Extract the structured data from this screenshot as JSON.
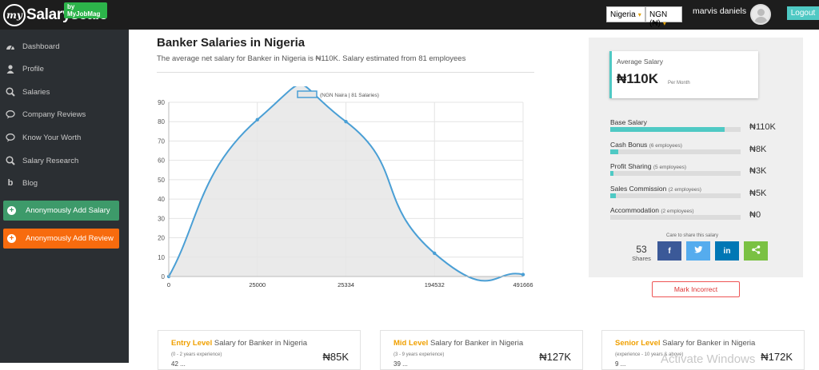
{
  "brand": {
    "logo_my": "my",
    "logo_name": "Salaryscale",
    "badge": "by MyJobMag"
  },
  "topbar": {
    "country": "Nigeria",
    "currency": "NGN (₦)",
    "username": "marvis daniels",
    "logout_label": "Logout"
  },
  "sidebar": {
    "items": [
      {
        "label": "Dashboard",
        "icon": "dashboard-icon"
      },
      {
        "label": "Profile",
        "icon": "user-icon"
      },
      {
        "label": "Salaries",
        "icon": "search-money-icon"
      },
      {
        "label": "Company Reviews",
        "icon": "chat-icon"
      },
      {
        "label": "Know Your Worth",
        "icon": "chat-icon"
      },
      {
        "label": "Salary Research",
        "icon": "search-money-icon"
      },
      {
        "label": "Blog",
        "icon": "blog-icon"
      }
    ],
    "add_salary_label": "Anonymously Add Salary",
    "add_review_label": "Anonymously Add Review"
  },
  "main": {
    "title": "Banker Salaries in Nigeria",
    "subtitle": "The average net salary for Banker in Nigeria is ₦110K. Salary estimated from 81 employees"
  },
  "chart_data": {
    "type": "area",
    "legend": "(NGN Naira | 81 Salaries)",
    "x_labels": [
      "0",
      "25000",
      "25334",
      "194532",
      "491666"
    ],
    "values": [
      0,
      81,
      80,
      12,
      1
    ],
    "ylim": [
      0,
      90
    ],
    "y_ticks": [
      0,
      10,
      20,
      30,
      40,
      50,
      60,
      70,
      80,
      90
    ],
    "grid": true,
    "colors": {
      "line": "#4a9fd5",
      "fill": "#e6e6e6"
    }
  },
  "summary": {
    "avg_label": "Average Salary",
    "avg_value": "₦110K",
    "avg_period": "Per Month",
    "components": [
      {
        "label": "Base Salary",
        "note": "",
        "value": "₦110K",
        "fraction": 0.875
      },
      {
        "label": "Cash Bonus",
        "note": "(6 employees)",
        "value": "₦8K",
        "fraction": 0.064
      },
      {
        "label": "Profit Sharing",
        "note": "(5 employees)",
        "value": "₦3K",
        "fraction": 0.024
      },
      {
        "label": "Sales Commission",
        "note": "(2 employees)",
        "value": "₦5K",
        "fraction": 0.04
      },
      {
        "label": "Accommodation",
        "note": "(2 employees)",
        "value": "₦0",
        "fraction": 0
      }
    ],
    "share_caption": "Care to share this salary",
    "shares_count": "53",
    "shares_label": "Shares",
    "share_buttons": [
      {
        "icon": "facebook-icon",
        "glyph": "f",
        "color": "#3b5998"
      },
      {
        "icon": "twitter-icon",
        "glyph": "🐦",
        "color": "#55acee"
      },
      {
        "icon": "linkedin-icon",
        "glyph": "in",
        "color": "#0077b5"
      },
      {
        "icon": "share-icon",
        "glyph": "<",
        "color": "#7ac143"
      }
    ],
    "mark_incorrect_label": "Mark Incorrect"
  },
  "levels": [
    {
      "level": "Entry Level",
      "rest": "Salary for Banker in Nigeria",
      "range": "(0 - 2 years experience)",
      "value": "₦85K",
      "cut": "42 ..."
    },
    {
      "level": "Mid Level",
      "rest": "Salary for Banker in Nigeria",
      "range": "(3 - 9 years experience)",
      "value": "₦127K",
      "cut": "39 ..."
    },
    {
      "level": "Senior Level",
      "rest": "Salary for Banker in Nigeria",
      "range": "(experience - 10 years & above)",
      "value": "₦172K",
      "cut": "9 ..."
    }
  ],
  "watermark": "Activate Windows"
}
